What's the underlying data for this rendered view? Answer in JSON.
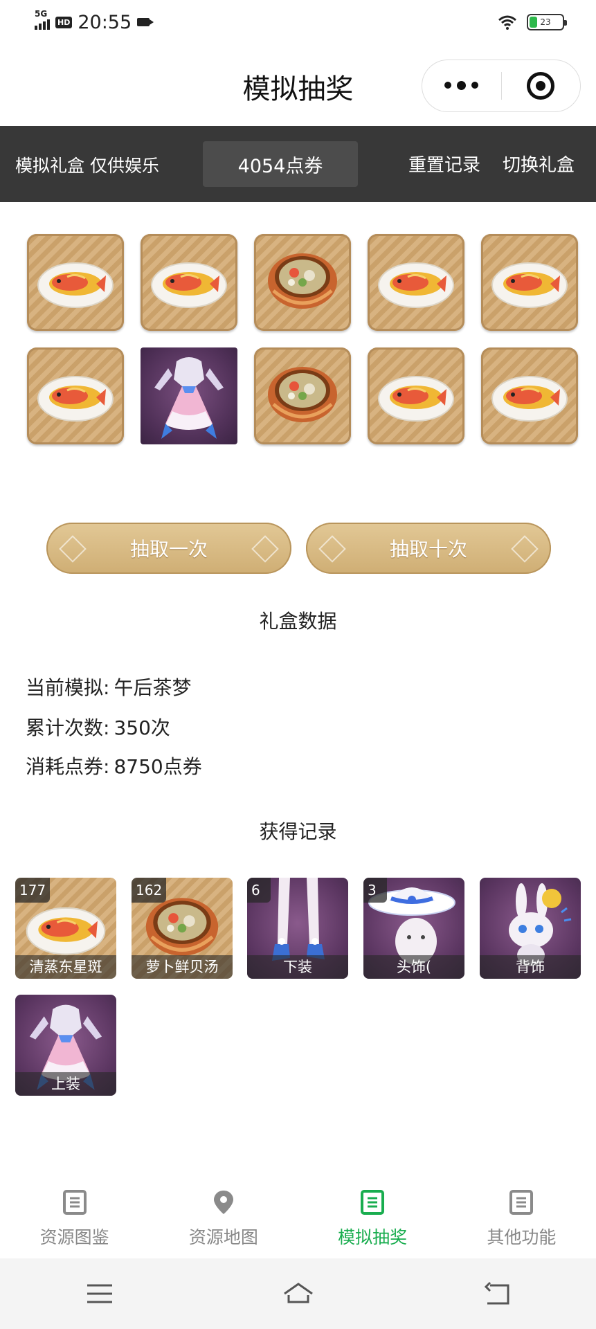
{
  "status_bar": {
    "network": "5G",
    "hd": "HD",
    "time": "20:55",
    "battery": "23",
    "battery_level": 0.23
  },
  "nav": {
    "title": "模拟抽奖",
    "more_icon": "more-dots-icon",
    "close_icon": "target-circle-icon"
  },
  "header": {
    "note": "模拟礼盒 仅供娱乐",
    "points": "4054点券",
    "reset": "重置记录",
    "switch": "切换礼盒"
  },
  "draw_grid": [
    {
      "item": "fish"
    },
    {
      "item": "fish"
    },
    {
      "item": "soup"
    },
    {
      "item": "fish"
    },
    {
      "item": "fish"
    },
    {
      "item": "fish"
    },
    {
      "item": "dress"
    },
    {
      "item": "soup"
    },
    {
      "item": "fish"
    },
    {
      "item": "fish"
    }
  ],
  "buttons": {
    "draw_once": "抽取一次",
    "draw_ten": "抽取十次"
  },
  "gift_data": {
    "title": "礼盒数据",
    "current_label": "当前模拟:",
    "current_value": "午后茶梦",
    "total_label": "累计次数:",
    "total_value": "350次",
    "spent_label": "消耗点券:",
    "spent_value": "8750点券"
  },
  "records": {
    "title": "获得记录",
    "items": [
      {
        "count": "177",
        "name": "清蒸东星斑",
        "item": "fish"
      },
      {
        "count": "162",
        "name": "萝卜鲜贝汤",
        "item": "soup"
      },
      {
        "count": "6",
        "name": "下装",
        "item": "legs"
      },
      {
        "count": "3",
        "name": "头饰(",
        "item": "hat"
      },
      {
        "count": "",
        "name": "背饰",
        "item": "pet"
      },
      {
        "count": "",
        "name": "上装",
        "item": "dress"
      }
    ]
  },
  "tabs": [
    {
      "label": "资源图鉴",
      "icon": "document-icon",
      "active": false
    },
    {
      "label": "资源地图",
      "icon": "location-pin-icon",
      "active": false
    },
    {
      "label": "模拟抽奖",
      "icon": "document-icon",
      "active": true
    },
    {
      "label": "其他功能",
      "icon": "document-icon",
      "active": false
    }
  ],
  "colors": {
    "active_tab": "#19ad4f",
    "header_bg": "#383838",
    "button_gold": "#d6b882"
  }
}
